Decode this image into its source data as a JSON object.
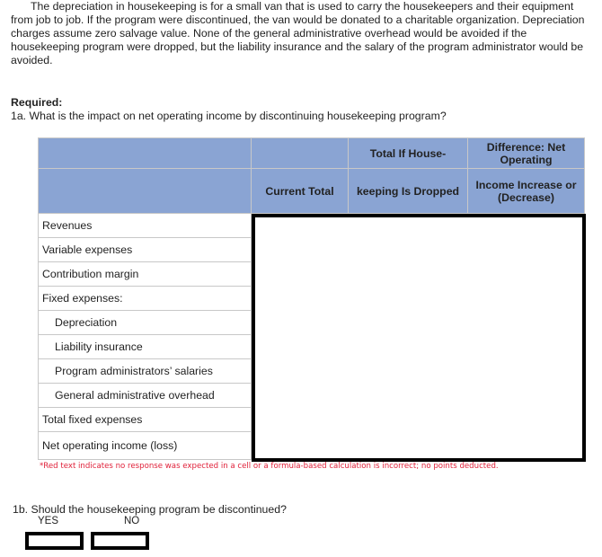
{
  "intro_paragraph": "The depreciation in housekeeping is for a small van that is used to carry the housekeepers and their equipment from job to job. If the program were discontinued, the van would be donated to a charitable organization. Depreciation charges assume zero salvage value. None of the general administrative overhead would be avoided if the housekeeping program were dropped, but the liability insurance and the salary of the program administrator would be avoided.",
  "required_label": "Required:",
  "question_1a": "1a.  What is the impact on net operating income by discontinuing housekeeping program?",
  "table": {
    "header_row1": [
      "",
      "",
      "Total If House-",
      "Difference: Net Operating"
    ],
    "header_row2": [
      "",
      "Current Total",
      "keeping Is Dropped",
      "Income Increase or (Decrease)"
    ],
    "rows": [
      {
        "label": "Revenues",
        "indent": false
      },
      {
        "label": "Variable expenses",
        "indent": false
      },
      {
        "label": "Contribution margin",
        "indent": false
      },
      {
        "label": "Fixed expenses:",
        "indent": false
      },
      {
        "label": "Depreciation",
        "indent": true
      },
      {
        "label": "Liability insurance",
        "indent": true
      },
      {
        "label": "Program administrators’ salaries",
        "indent": true
      },
      {
        "label": "General administrative overhead",
        "indent": true
      },
      {
        "label": "Total fixed expenses",
        "indent": false
      },
      {
        "label": "Net operating income (loss)",
        "indent": false
      }
    ]
  },
  "note": "*Red text indicates no response was expected in a cell or a formula-based calculation is incorrect; no points deducted.",
  "question_1b": "1b.  Should the housekeeping program be discontinued?",
  "choices": {
    "yes": "YES",
    "no": "NO"
  },
  "colors": {
    "header_bg": "#8aa4d3",
    "note_red": "#e0213a",
    "answer_border": "#000000"
  }
}
